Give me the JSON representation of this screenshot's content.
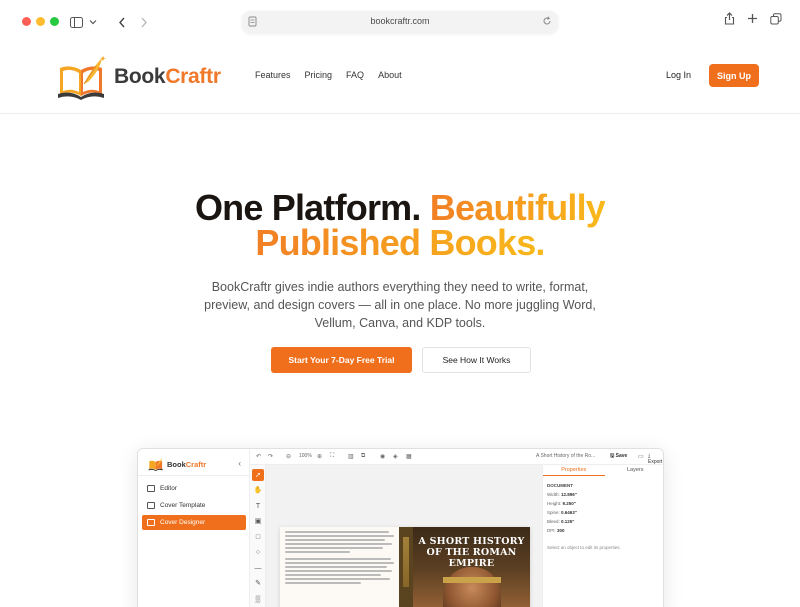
{
  "browser": {
    "url": "bookcraftr.com"
  },
  "site": {
    "brand_main": "Book",
    "brand_accent": "Craftr",
    "nav_links": [
      "Features",
      "Pricing",
      "FAQ",
      "About"
    ],
    "login_label": "Log In",
    "signup_label": "Sign Up",
    "accent_color": "#f06f1c"
  },
  "hero": {
    "title_part1": "One Platform.",
    "title_part2": "Beautifully",
    "title_line2": "Published Books.",
    "subtitle": "BookCraftr gives indie authors everything they need to write, format, preview, and design covers — all in one place. No more juggling Word, Vellum, Canva, and KDP tools.",
    "cta_primary": "Start Your 7-Day Free Trial",
    "cta_secondary": "See How It Works"
  },
  "preview": {
    "brand_main": "Book",
    "brand_accent": "Craftr",
    "sidebar_items": [
      {
        "label": "Editor",
        "active": false
      },
      {
        "label": "Cover Template",
        "active": false
      },
      {
        "label": "Cover Designer",
        "active": true
      }
    ],
    "topbar": {
      "zoom": "100%",
      "doc_title": "A Short History of the Ro...",
      "save_label": "Save",
      "export_label": "Export"
    },
    "book_front_title": "A SHORT HISTORY OF THE ROMAN EMPIRE",
    "props": {
      "tab_properties": "Properties",
      "tab_layers": "Layers",
      "section": "DOCUMENT",
      "width_label": "Width:",
      "width_value": "12.896\"",
      "height_label": "Height:",
      "height_value": "9.250\"",
      "spine_label": "Spine:",
      "spine_value": "0.6463\"",
      "bleed_label": "Bleed:",
      "bleed_value": "0.125\"",
      "dpi_label": "DPI:",
      "dpi_value": "300",
      "hint": "Select an object to edit its properties."
    }
  }
}
